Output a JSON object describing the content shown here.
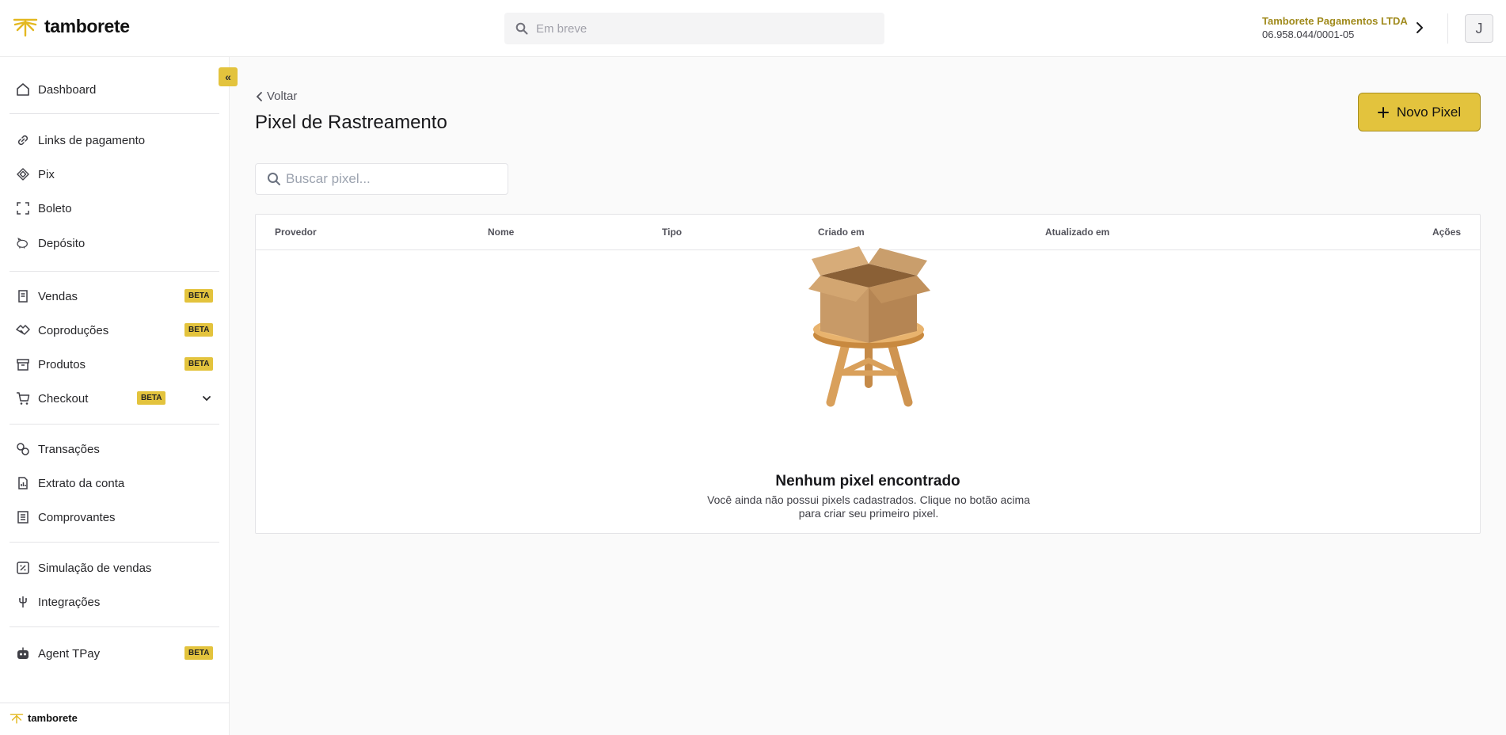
{
  "header": {
    "logo_text": "tamborete",
    "search_placeholder": "Em breve",
    "company_name": "Tamborete Pagamentos LTDA",
    "company_cnpj": "06.958.044/0001-05",
    "avatar_initial": "J"
  },
  "sidebar": {
    "collapse_label": "«",
    "badge": "BETA",
    "items": [
      {
        "label": "Dashboard",
        "icon": "home-icon"
      },
      {
        "label": "Links de pagamento",
        "icon": "link-icon"
      },
      {
        "label": "Pix",
        "icon": "pix-icon"
      },
      {
        "label": "Boleto",
        "icon": "barcode-scan-icon"
      },
      {
        "label": "Depósito",
        "icon": "piggy-bank-icon"
      },
      {
        "label": "Vendas",
        "icon": "receipt-icon",
        "beta": true
      },
      {
        "label": "Coproduções",
        "icon": "handshake-icon",
        "beta": true
      },
      {
        "label": "Produtos",
        "icon": "archive-box-icon",
        "beta": true
      },
      {
        "label": "Checkout",
        "icon": "cart-icon",
        "beta": true
      },
      {
        "label": "Transações",
        "icon": "exchange-icon"
      },
      {
        "label": "Extrato da conta",
        "icon": "statement-icon"
      },
      {
        "label": "Comprovantes",
        "icon": "list-icon"
      },
      {
        "label": "Simulação de vendas",
        "icon": "percent-icon"
      },
      {
        "label": "Integrações",
        "icon": "plug-icon"
      },
      {
        "label": "Agent TPay",
        "icon": "robot-icon",
        "beta": true
      }
    ],
    "footer_logo_text": "tamborete"
  },
  "main": {
    "back_label": "Voltar",
    "title": "Pixel de Rastreamento",
    "new_button_label": "Novo Pixel",
    "search_placeholder": "Buscar pixel...",
    "table": {
      "columns": [
        "Provedor",
        "Nome",
        "Tipo",
        "Criado em",
        "Atualizado em",
        "Ações"
      ]
    },
    "empty_state": {
      "title": "Nenhum pixel encontrado",
      "description": "Você ainda não possui pixels cadastrados. Clique no botão acima para criar seu primeiro pixel."
    }
  },
  "colors": {
    "accent": "#e3c33d",
    "company_name": "#a08a1c",
    "background": "#fafafa"
  }
}
